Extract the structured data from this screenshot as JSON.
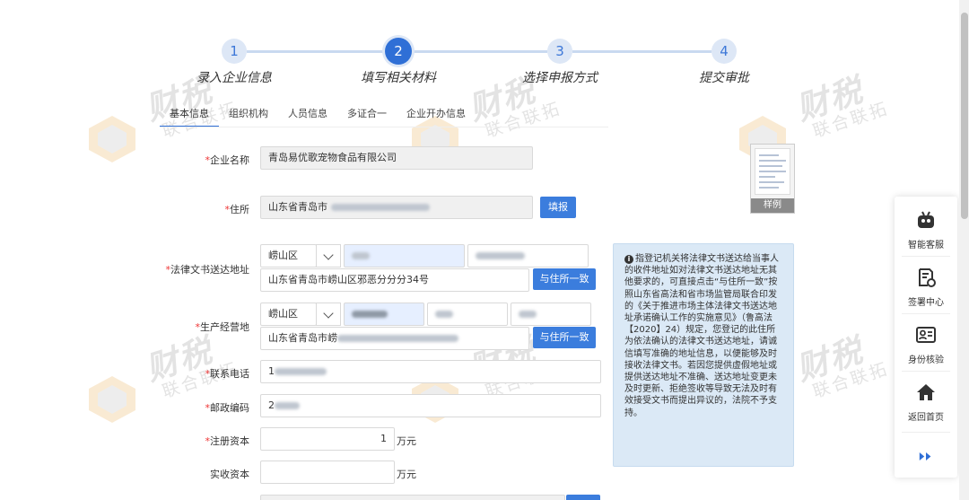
{
  "steps": [
    {
      "num": "1",
      "label": "录入企业信息"
    },
    {
      "num": "2",
      "label": "填写相关材料"
    },
    {
      "num": "3",
      "label": "选择申报方式"
    },
    {
      "num": "4",
      "label": "提交审批"
    }
  ],
  "tabs": [
    "基本信息",
    "组织机构",
    "人员信息",
    "多证合一",
    "企业开办信息"
  ],
  "form": {
    "company_name": {
      "label": "企业名称",
      "value": "青岛易优歌宠物食品有限公司"
    },
    "address": {
      "label": "住所",
      "value": "山东省青岛市",
      "button": "填报"
    },
    "legal_address": {
      "label": "法律文书送达地址",
      "district": "崂山区",
      "full": "山东省青岛市崂山区邪恶分分分34号",
      "button": "与住所一致"
    },
    "business_address": {
      "label": "生产经营地",
      "district": "崂山区",
      "full": "山东省青岛市崂",
      "button": "与住所一致"
    },
    "phone": {
      "label": "联系电话",
      "value": "1"
    },
    "postcode": {
      "label": "邮政编码",
      "value": "2"
    },
    "registered_capital": {
      "label": "注册资本",
      "value": "1",
      "unit": "万元"
    },
    "paid_capital": {
      "label": "实收资本",
      "value": "",
      "unit": "万元"
    },
    "required_mark": "*"
  },
  "info_box": {
    "icon": "i",
    "text": "指登记机关将法律文书送达给当事人的收件地址如对法律文书送达地址无其他要求的，可直接点击“与住所一致”按照山东省高法和省市场监管局联合印发的《关于推进市场主体法律文书送达地址承诺确认工作的实施意见》（鲁高法【2020】24）规定，您登记的此住所为依法确认的法律文书送达地址，请诚信填写准确的地址信息，以便能够及时接收法律文书。若因您提供虚假地址或提供送达地址不准确、送达地址变更未及时更新、拒绝签收等导致无法及时有效接受文书而提出异议的，法院不予支持。"
  },
  "sample": {
    "label": "样例"
  },
  "sidebar": [
    {
      "icon": "robot-icon",
      "label": "智能客服"
    },
    {
      "icon": "sign-icon",
      "label": "签署中心"
    },
    {
      "icon": "id-card-icon",
      "label": "身份核验"
    },
    {
      "icon": "home-icon",
      "label": "返回首页"
    }
  ],
  "watermark": {
    "line1": "财税",
    "line2": "联合联拓"
  },
  "colors": {
    "primary": "#2f6fd6",
    "button": "#3b7ddd",
    "info_bg": "#dbe9f6",
    "required": "#ee3333"
  }
}
